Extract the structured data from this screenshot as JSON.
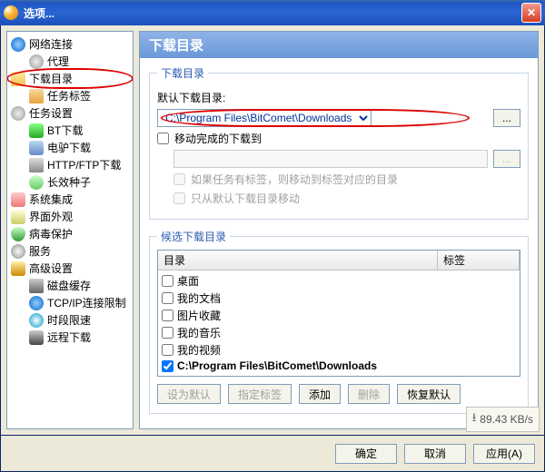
{
  "window": {
    "title": "选项..."
  },
  "tree": {
    "items": [
      {
        "label": "网络连接",
        "lvl": 1,
        "icon": "ic-globe"
      },
      {
        "label": "代理",
        "lvl": 2,
        "icon": "ic-gear"
      },
      {
        "label": "下载目录",
        "lvl": 1,
        "icon": "ic-folder",
        "highlight": true
      },
      {
        "label": "任务标签",
        "lvl": 2,
        "icon": "ic-tag"
      },
      {
        "label": "任务设置",
        "lvl": 1,
        "icon": "ic-gear"
      },
      {
        "label": "BT下载",
        "lvl": 2,
        "icon": "ic-green"
      },
      {
        "label": "电驴下载",
        "lvl": 2,
        "icon": "ic-don"
      },
      {
        "label": "HTTP/FTP下载",
        "lvl": 2,
        "icon": "ic-http"
      },
      {
        "label": "长效种子",
        "lvl": 2,
        "icon": "ic-seed"
      },
      {
        "label": "系统集成",
        "lvl": 1,
        "icon": "ic-people"
      },
      {
        "label": "界面外观",
        "lvl": 1,
        "icon": "ic-ui"
      },
      {
        "label": "病毒保护",
        "lvl": 1,
        "icon": "ic-shield"
      },
      {
        "label": "服务",
        "lvl": 1,
        "icon": "ic-svc"
      },
      {
        "label": "高级设置",
        "lvl": 1,
        "icon": "ic-key"
      },
      {
        "label": "磁盘缓存",
        "lvl": 2,
        "icon": "ic-disk"
      },
      {
        "label": "TCP/IP连接限制",
        "lvl": 2,
        "icon": "ic-net"
      },
      {
        "label": "时段限速",
        "lvl": 2,
        "icon": "ic-clock"
      },
      {
        "label": "远程下载",
        "lvl": 2,
        "icon": "ic-remote"
      }
    ]
  },
  "page": {
    "heading": "下载目录",
    "group1": {
      "legend": "下载目录",
      "default_label": "默认下载目录:",
      "default_path": "C:\\Program Files\\BitComet\\Downloads",
      "browse": "...",
      "move_done_label": "移动完成的下载到",
      "move_done_path": "",
      "move_tag_label": "如果任务有标签，则移动到标签对应的目录",
      "move_default_only_label": "只从默认下载目录移动"
    },
    "group2": {
      "legend": "候选下载目录",
      "col_dir": "目录",
      "col_tag": "标签",
      "items": [
        {
          "label": "桌面",
          "checked": false
        },
        {
          "label": "我的文档",
          "checked": false
        },
        {
          "label": "图片收藏",
          "checked": false
        },
        {
          "label": "我的音乐",
          "checked": false
        },
        {
          "label": "我的视频",
          "checked": false
        },
        {
          "label": "C:\\Program Files\\BitComet\\Downloads",
          "checked": true,
          "bold": true
        }
      ],
      "btn_setdefault": "设为默认",
      "btn_settag": "指定标签",
      "btn_add": "添加",
      "btn_delete": "删除",
      "btn_restore": "恢复默认"
    }
  },
  "buttons": {
    "ok": "确定",
    "cancel": "取消",
    "apply": "应用(A)"
  },
  "status": {
    "speed": "89.43 KB/s"
  }
}
